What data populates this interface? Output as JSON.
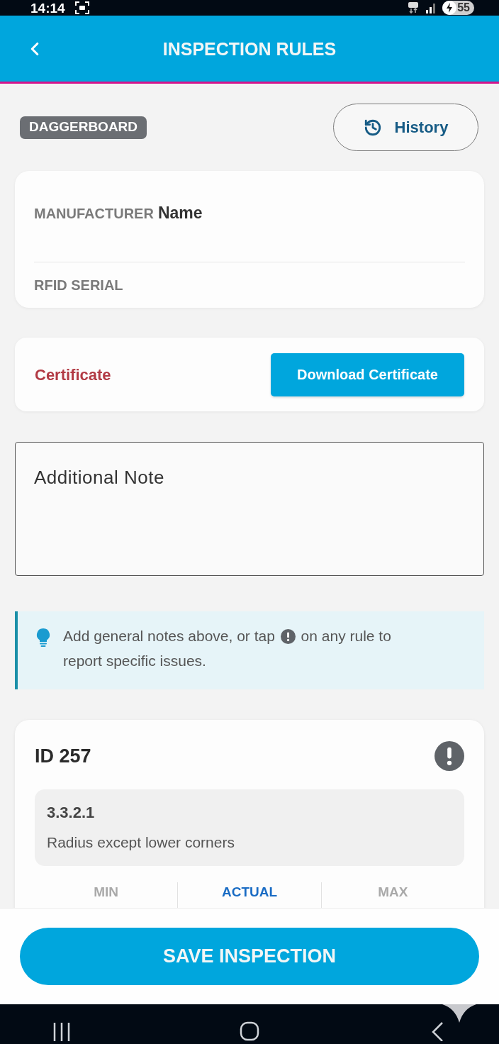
{
  "status_bar": {
    "time": "14:14",
    "battery": "55"
  },
  "header": {
    "title": "INSPECTION RULES"
  },
  "badge": "DAGGERBOARD",
  "history_button": {
    "label": "History"
  },
  "details": [
    {
      "label": "MANUFACTURER",
      "value": "Name"
    },
    {
      "label": "RFID SERIAL"
    }
  ],
  "certificate": {
    "label": "Certificate",
    "button": "Download Certificate"
  },
  "note_field": {
    "placeholder": "Additional Note"
  },
  "hint": {
    "text_before": "Add general notes above, or tap",
    "text_after": "on any rule to report specific issues."
  },
  "rules": [
    {
      "id": "ID 257",
      "code": "3.3.2.1",
      "description": "Radius except lower corners",
      "columns": [
        {
          "kind": "limit",
          "label": "MIN"
        },
        {
          "kind": "actual",
          "label": "ACTUAL"
        },
        {
          "kind": "limit",
          "label": "MAX"
        }
      ]
    }
  ],
  "save_button": "SAVE INSPECTION"
}
